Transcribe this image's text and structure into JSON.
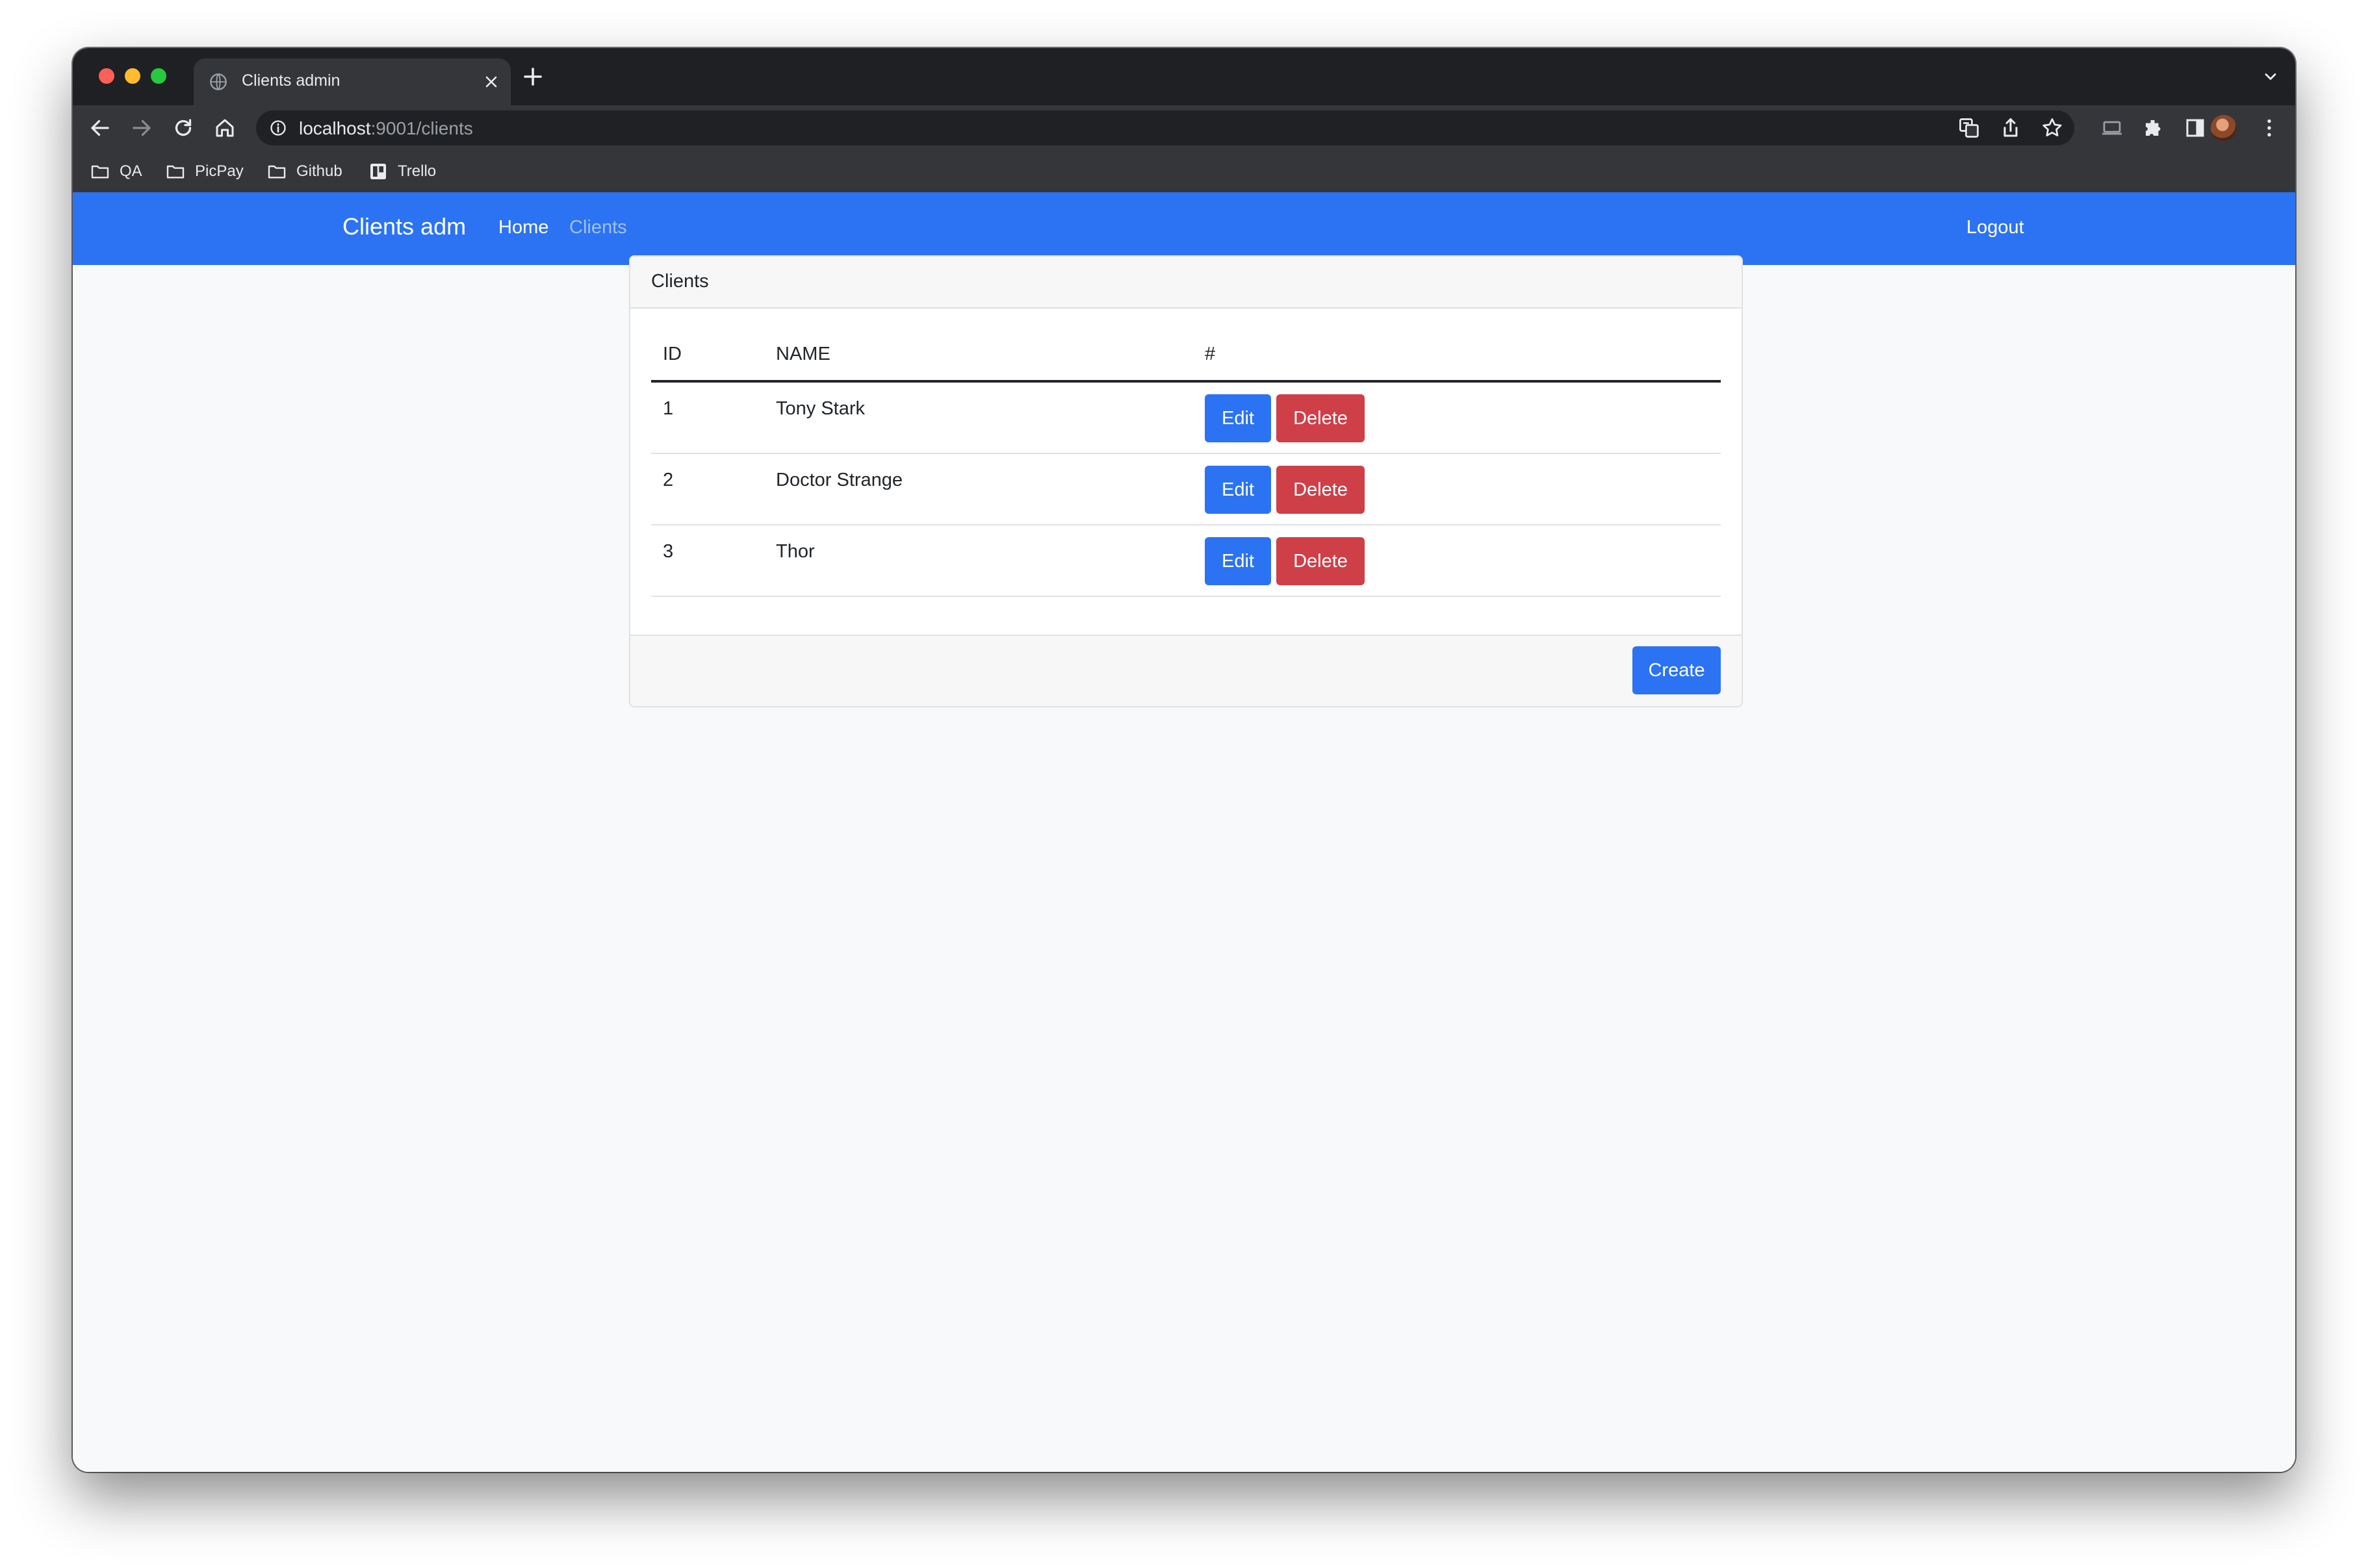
{
  "browser": {
    "tab_title": "Clients admin",
    "url_host": "localhost",
    "url_rest": ":9001/clients",
    "bookmarks": [
      {
        "label": "QA",
        "icon": "folder-icon"
      },
      {
        "label": "PicPay",
        "icon": "folder-icon"
      },
      {
        "label": "Github",
        "icon": "folder-icon"
      },
      {
        "label": "Trello",
        "icon": "trello-icon"
      }
    ]
  },
  "navbar": {
    "brand": "Clients adm",
    "links": [
      "Home",
      "Clients"
    ],
    "logout": "Logout",
    "color": "#2b73f2"
  },
  "card": {
    "title": "Clients",
    "columns": [
      "ID",
      "NAME",
      "#"
    ],
    "rows": [
      {
        "id": "1",
        "name": "Tony Stark",
        "edit": "Edit",
        "delete": "Delete"
      },
      {
        "id": "2",
        "name": "Doctor Strange",
        "edit": "Edit",
        "delete": "Delete"
      },
      {
        "id": "3",
        "name": "Thor",
        "edit": "Edit",
        "delete": "Delete"
      }
    ],
    "create_label": "Create"
  },
  "colors": {
    "primary": "#2b73f2",
    "danger": "#cf3f48"
  }
}
